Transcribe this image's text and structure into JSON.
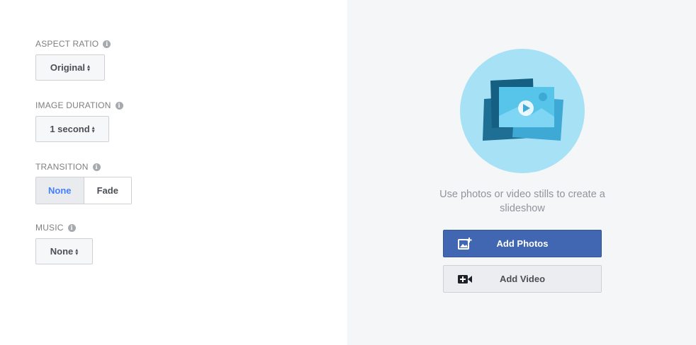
{
  "settings": {
    "aspect_ratio": {
      "label": "ASPECT RATIO",
      "value": "Original"
    },
    "image_duration": {
      "label": "IMAGE DURATION",
      "value": "1 second"
    },
    "transition": {
      "label": "TRANSITION",
      "options": [
        "None",
        "Fade"
      ],
      "selected": "None"
    },
    "music": {
      "label": "MUSIC",
      "value": "None"
    }
  },
  "info_glyph": "i",
  "preview": {
    "hint": "Use photos or video stills to create a slideshow",
    "add_photos_label": "Add Photos",
    "add_video_label": "Add Video"
  },
  "colors": {
    "primary": "#4267b2",
    "selected_text": "#4080ff",
    "illustration_bg": "#a7e1f6"
  },
  "icons": {
    "photos": "add-photo-icon",
    "video": "video-camera-icon",
    "info": "info-icon"
  }
}
